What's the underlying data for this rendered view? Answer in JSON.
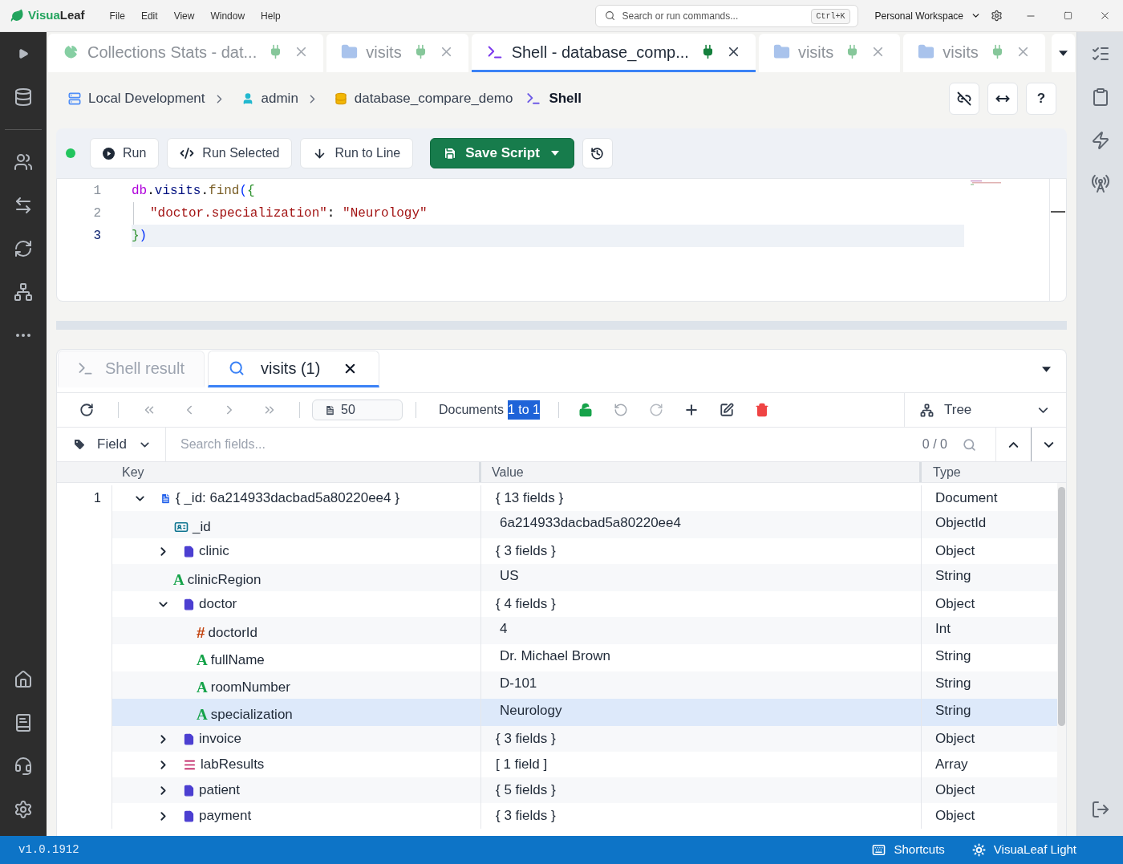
{
  "title_bar": {
    "logo": {
      "first": "Visua",
      "second": "Leaf"
    },
    "menu": [
      "File",
      "Edit",
      "View",
      "Window",
      "Help"
    ],
    "search": {
      "placeholder": "Search or run commands...",
      "shortcut": "Ctrl+K"
    },
    "workspace": "Personal Workspace"
  },
  "tabs": [
    {
      "label": "Collections Stats - dat...",
      "kind": "stats",
      "selected": false
    },
    {
      "label": "visits",
      "kind": "collection",
      "selected": false
    },
    {
      "label": "Shell - database_comp...",
      "kind": "shell",
      "selected": true
    },
    {
      "label": "visits",
      "kind": "collection",
      "selected": false
    },
    {
      "label": "visits",
      "kind": "collection",
      "selected": false
    }
  ],
  "breadcrumb": [
    {
      "label": "Local Development",
      "kind": "connection"
    },
    {
      "label": "admin",
      "kind": "user"
    },
    {
      "label": "database_compare_demo",
      "kind": "database"
    },
    {
      "label": "Shell",
      "kind": "shell"
    }
  ],
  "help_button": "?",
  "shell_toolbar": {
    "connected": true,
    "buttons": [
      {
        "label": "Run",
        "kind": "run"
      },
      {
        "label": "Run Selected",
        "kind": "run_selected"
      },
      {
        "label": "Run to Line",
        "kind": "run_to_line"
      },
      {
        "label": "Save Script",
        "kind": "save"
      }
    ]
  },
  "editor": {
    "lines": [
      {
        "number": "1",
        "current": false,
        "indented": false,
        "tokens": [
          {
            "text": "db",
            "kind": "variable"
          },
          {
            "text": ".",
            "kind": "plain"
          },
          {
            "text": "visits",
            "kind": "property"
          },
          {
            "text": ".",
            "kind": "plain"
          },
          {
            "text": "find",
            "kind": "function"
          },
          {
            "text": "(",
            "kind": "bracket_outer"
          },
          {
            "text": "{",
            "kind": "bracket_inner"
          }
        ]
      },
      {
        "number": "2",
        "current": false,
        "indented": true,
        "tokens": [
          {
            "text": "\"doctor.specialization\"",
            "kind": "string"
          },
          {
            "text": ": ",
            "kind": "plain"
          },
          {
            "text": "\"Neurology\"",
            "kind": "string"
          }
        ]
      },
      {
        "number": "3",
        "current": true,
        "indented": false,
        "tokens": [
          {
            "text": "}",
            "kind": "bracket_inner"
          },
          {
            "text": ")",
            "kind": "bracket_outer"
          }
        ]
      }
    ]
  },
  "results": {
    "tabs": [
      {
        "label": "Shell result",
        "kind": "shell",
        "selected": false
      },
      {
        "label": "visits (1)",
        "kind": "query",
        "selected": true
      }
    ],
    "toolbar": {
      "page_size": "50",
      "documents_label": "Documents",
      "range": "1 to 1",
      "range_highlighted": true,
      "locked": false,
      "undo_disabled": true,
      "redo_disabled": true,
      "view_mode": "Tree"
    },
    "filter": {
      "field": "Field",
      "placeholder": "Search fields...",
      "match_count": "0 / 0"
    },
    "columns": [
      "Key",
      "Value",
      "Type"
    ],
    "documents": [
      {
        "number": "1",
        "key": "{ _id: 6a214933dacbad5a80220ee4 }",
        "value": "{ 13 fields }",
        "type": "Document",
        "kind": "document",
        "expanded": true,
        "selected": false,
        "children": [
          {
            "key": "_id",
            "value": "6a214933dacbad5a80220ee4",
            "type": "ObjectId",
            "kind": "objectid",
            "selected": false
          },
          {
            "key": "clinic",
            "value": "{ 3 fields }",
            "type": "Object",
            "kind": "object",
            "expanded": false,
            "selected": false
          },
          {
            "key": "clinicRegion",
            "value": "US",
            "type": "String",
            "kind": "string",
            "glyph": "A",
            "selected": false
          },
          {
            "key": "doctor",
            "value": "{ 4 fields }",
            "type": "Object",
            "kind": "object",
            "expanded": true,
            "selected": false,
            "children": [
              {
                "key": "doctorId",
                "value": "4",
                "type": "Int",
                "kind": "int",
                "glyph": "#",
                "selected": false
              },
              {
                "key": "fullName",
                "value": "Dr. Michael Brown",
                "type": "String",
                "kind": "string",
                "glyph": "A",
                "selected": false
              },
              {
                "key": "roomNumber",
                "value": "D-101",
                "type": "String",
                "kind": "string",
                "glyph": "A",
                "selected": false
              },
              {
                "key": "specialization",
                "value": "Neurology",
                "type": "String",
                "kind": "string",
                "glyph": "A",
                "selected": true
              }
            ]
          },
          {
            "key": "invoice",
            "value": "{ 3 fields }",
            "type": "Object",
            "kind": "object",
            "expanded": false,
            "selected": false
          },
          {
            "key": "labResults",
            "value": "[ 1 field ]",
            "type": "Array",
            "kind": "array",
            "expanded": false,
            "selected": false
          },
          {
            "key": "patient",
            "value": "{ 5 fields }",
            "type": "Object",
            "kind": "object",
            "expanded": false,
            "selected": false
          },
          {
            "key": "payment",
            "value": "{ 3 fields }",
            "type": "Object",
            "kind": "object",
            "expanded": false,
            "selected": false
          }
        ]
      }
    ]
  },
  "status_bar": {
    "version": "v1.0.1912",
    "items": [
      {
        "label": "Shortcuts",
        "kind": "shortcuts"
      },
      {
        "label": "VisuaLeaf Light",
        "kind": "theme"
      }
    ]
  }
}
